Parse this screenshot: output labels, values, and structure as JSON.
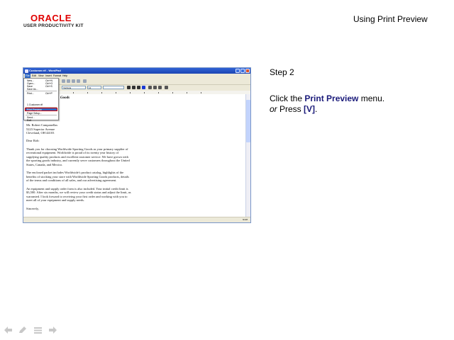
{
  "header": {
    "brand": "ORACLE",
    "product": "USER PRODUCTIVITY KIT",
    "page_title": "Using Print Preview"
  },
  "screenshot": {
    "window_title": "Customer.rtf - WordPad",
    "menu": [
      "File",
      "Edit",
      "View",
      "Insert",
      "Format",
      "Help"
    ],
    "font_name": "Verdana",
    "font_size": "12",
    "file_menu": [
      {
        "label": "New...",
        "shortcut": "Ctrl+N"
      },
      {
        "label": "Open...",
        "shortcut": "Ctrl+O"
      },
      {
        "label": "Save",
        "shortcut": "Ctrl+S"
      },
      {
        "label": "Save As...",
        "shortcut": ""
      },
      {
        "label": "Print...",
        "shortcut": "Ctrl+P"
      },
      {
        "label": "Print Preview",
        "shortcut": ""
      },
      {
        "label": "Page Setup...",
        "shortcut": ""
      },
      {
        "label": "1 Customer.rtf",
        "shortcut": ""
      },
      {
        "label": "Send...",
        "shortcut": ""
      },
      {
        "label": "Exit",
        "shortcut": ""
      }
    ],
    "doc_heading": "Goods",
    "doc_lines": [
      "Mr. Robert Campanellas",
      "5223 Superior Avenue",
      "Cleveland, OH  44103",
      "",
      "Dear Rob:",
      "",
      "Thank you for choosing Worldwide Sporting Goods as your primary supplier of",
      "recreational equipment. Worldwide is proud of its twenty year history of",
      "supplying quality products and excellent customer service. We have grown with",
      "the sporting goods industry, and currently serve customers throughout the United",
      "States, Canada, and Mexico.",
      "",
      "The enclosed packet includes Worldwide's product catalog, highlights of the",
      "benefits of stocking your store with Worldwide Sporting Goods products, details",
      "of the terms and conditions of all sales, and our advertising agreement.",
      "",
      "An equipment and supply order form is also included. Your initial credit limit is",
      "$3,500. After six months, we will review your credit status and adjust the limit, as",
      "warranted. I look forward to receiving your first order and working with you to",
      "meet all of your equipment and supply needs.",
      "",
      "Sincerely,"
    ],
    "status": "NUM"
  },
  "instructions": {
    "step": "Step 2",
    "line1_pre": "Click the ",
    "line1_bold": "Print Preview",
    "line1_post": " menu.",
    "line2_or": "or",
    "line2_pre": " Press ",
    "line2_key": "[V]",
    "line2_post": "."
  },
  "nav": {
    "icons": [
      "back-arrow-icon",
      "pen-icon",
      "menu-icon",
      "forward-arrow-icon"
    ],
    "color": "#c8c8c8"
  }
}
